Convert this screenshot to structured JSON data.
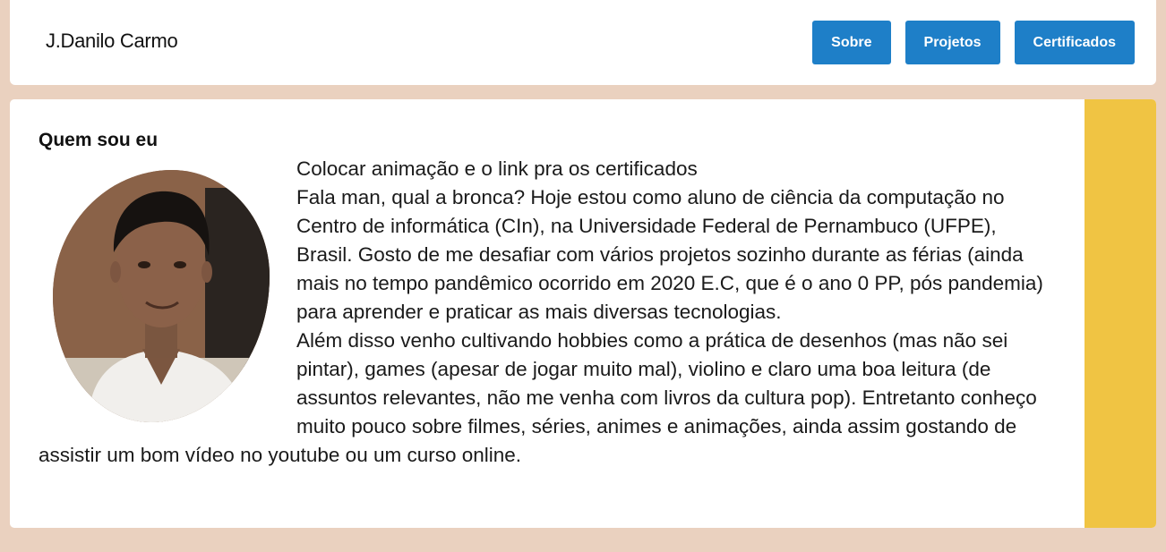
{
  "header": {
    "title": "J.Danilo Carmo",
    "nav": [
      "Sobre",
      "Projetos",
      "Certificados"
    ]
  },
  "about": {
    "title": "Quem sou eu",
    "avatar_icon": "profile-photo",
    "paragraphs": [
      "Colocar animação e o link pra os certificados",
      "Fala man, qual a bronca? Hoje estou como aluno de ciência da computação no Centro de informática (CIn), na Universidade Federal de Pernambuco (UFPE), Brasil. Gosto de me desafiar com vários projetos sozinho durante as férias (ainda mais no tempo pandêmico ocorrido em 2020 E.C, que é o ano 0 PP, pós pandemia) para aprender e praticar as mais diversas tecnologias.",
      "Além disso venho cultivando hobbies como a prática de desenhos (mas não sei pintar), games (apesar de jogar muito mal), violino e claro uma boa leitura (de assuntos relevantes, não me venha com livros da cultura pop). Entretanto conheço muito pouco sobre filmes, séries, animes e animações, ainda assim gostando de assistir um bom vídeo no youtube ou um curso online."
    ]
  },
  "colors": {
    "background": "#ead1bf",
    "button": "#1e7fc8",
    "accent": "#f0c443"
  }
}
